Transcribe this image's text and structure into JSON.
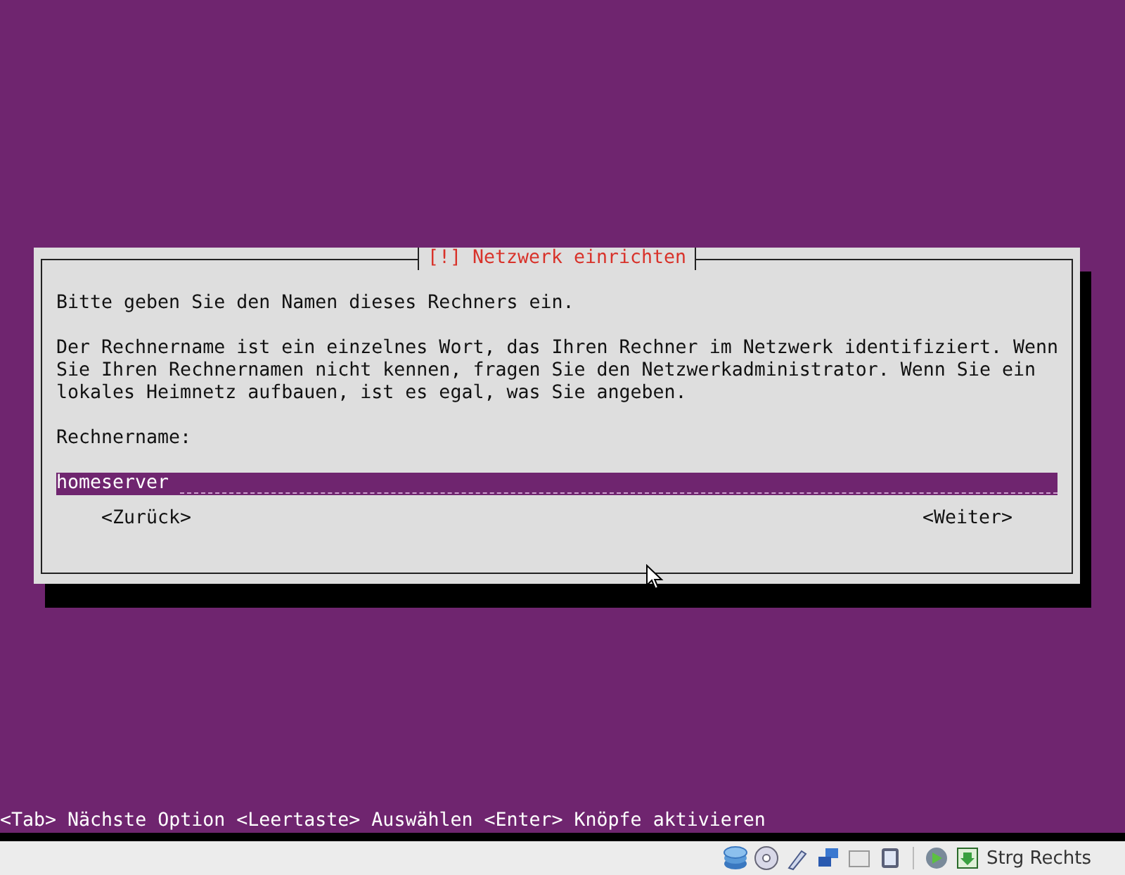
{
  "dialog": {
    "title": "[!] Netzwerk einrichten",
    "prompt": "Bitte geben Sie den Namen dieses Rechners ein.",
    "description": "Der Rechnername ist ein einzelnes Wort, das Ihren Rechner im Netzwerk identifiziert. Wenn Sie Ihren Rechnernamen nicht kennen, fragen Sie den Netzwerkadministrator. Wenn Sie ein lokales Heimnetz aufbauen, ist es egal, was Sie angeben.",
    "field_label": "Rechnername:",
    "field_value": "homeserver",
    "buttons": [
      "<Zurück>",
      "<Weiter>"
    ]
  },
  "help_line": "<Tab> Nächste Option <Leertaste> Auswählen <Enter> Knöpfe aktivieren",
  "status_bar": {
    "host_key": "Strg Rechts"
  }
}
